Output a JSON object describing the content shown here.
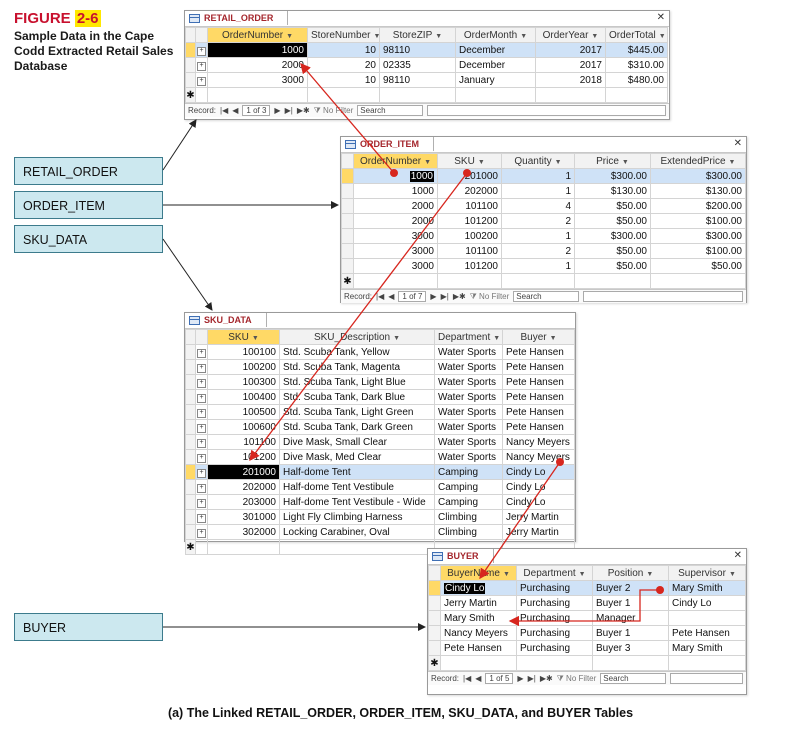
{
  "figure": {
    "label": "FIGURE",
    "number": "2-6",
    "caption": "Sample Data in the Cape Codd Extracted Retail Sales Database",
    "bottom_caption": "(a) The Linked RETAIL_ORDER, ORDER_ITEM, SKU_DATA, and BUYER Tables"
  },
  "side_labels": [
    "RETAIL_ORDER",
    "ORDER_ITEM",
    "SKU_DATA",
    "BUYER"
  ],
  "retail_order": {
    "title": "RETAIL_ORDER",
    "columns": [
      "OrderNumber",
      "StoreNumber",
      "StoreZIP",
      "OrderMonth",
      "OrderYear",
      "OrderTotal"
    ],
    "rows": [
      [
        "1000",
        "10",
        "98110",
        "December",
        "2017",
        "$445.00"
      ],
      [
        "2000",
        "20",
        "02335",
        "December",
        "2017",
        "$310.00"
      ],
      [
        "3000",
        "10",
        "98110",
        "January",
        "2018",
        "$480.00"
      ]
    ],
    "record_label": "Record:",
    "record_pos": "1 of 3",
    "filter": "No Filter",
    "search": "Search"
  },
  "order_item": {
    "title": "ORDER_ITEM",
    "columns": [
      "OrderNumber",
      "SKU",
      "Quantity",
      "Price",
      "ExtendedPrice"
    ],
    "rows": [
      [
        "1000",
        "201000",
        "1",
        "$300.00",
        "$300.00"
      ],
      [
        "1000",
        "202000",
        "1",
        "$130.00",
        "$130.00"
      ],
      [
        "2000",
        "101100",
        "4",
        "$50.00",
        "$200.00"
      ],
      [
        "2000",
        "101200",
        "2",
        "$50.00",
        "$100.00"
      ],
      [
        "3000",
        "100200",
        "1",
        "$300.00",
        "$300.00"
      ],
      [
        "3000",
        "101100",
        "2",
        "$50.00",
        "$100.00"
      ],
      [
        "3000",
        "101200",
        "1",
        "$50.00",
        "$50.00"
      ]
    ],
    "record_label": "Record:",
    "record_pos": "1 of 7",
    "filter": "No Filter",
    "search": "Search"
  },
  "sku_data": {
    "title": "SKU_DATA",
    "columns": [
      "SKU",
      "SKU_Description",
      "Department",
      "Buyer"
    ],
    "rows": [
      [
        "100100",
        "Std. Scuba Tank, Yellow",
        "Water Sports",
        "Pete Hansen"
      ],
      [
        "100200",
        "Std. Scuba Tank, Magenta",
        "Water Sports",
        "Pete Hansen"
      ],
      [
        "100300",
        "Std. Scuba Tank, Light Blue",
        "Water Sports",
        "Pete Hansen"
      ],
      [
        "100400",
        "Std. Scuba Tank, Dark Blue",
        "Water Sports",
        "Pete Hansen"
      ],
      [
        "100500",
        "Std. Scuba Tank, Light Green",
        "Water Sports",
        "Pete Hansen"
      ],
      [
        "100600",
        "Std. Scuba Tank, Dark Green",
        "Water Sports",
        "Pete Hansen"
      ],
      [
        "101100",
        "Dive Mask, Small Clear",
        "Water Sports",
        "Nancy Meyers"
      ],
      [
        "101200",
        "Dive Mask, Med Clear",
        "Water Sports",
        "Nancy Meyers"
      ],
      [
        "201000",
        "Half-dome Tent",
        "Camping",
        "Cindy Lo"
      ],
      [
        "202000",
        "Half-dome Tent Vestibule",
        "Camping",
        "Cindy Lo"
      ],
      [
        "203000",
        "Half-dome Tent Vestibule - Wide",
        "Camping",
        "Cindy Lo"
      ],
      [
        "301000",
        "Light Fly Climbing Harness",
        "Climbing",
        "Jerry Martin"
      ],
      [
        "302000",
        "Locking Carabiner, Oval",
        "Climbing",
        "Jerry Martin"
      ]
    ]
  },
  "buyer": {
    "title": "BUYER",
    "columns": [
      "BuyerName",
      "Department",
      "Position",
      "Supervisor"
    ],
    "rows": [
      [
        "Cindy Lo",
        "Purchasing",
        "Buyer 2",
        "Mary Smith"
      ],
      [
        "Jerry Martin",
        "Purchasing",
        "Buyer 1",
        "Cindy Lo"
      ],
      [
        "Mary Smith",
        "Purchasing",
        "Manager",
        ""
      ],
      [
        "Nancy Meyers",
        "Purchasing",
        "Buyer 1",
        "Pete Hansen"
      ],
      [
        "Pete Hansen",
        "Purchasing",
        "Buyer 3",
        "Mary Smith"
      ]
    ],
    "record_label": "Record:",
    "record_pos": "1 of 5",
    "filter": "No Filter",
    "search": "Search"
  },
  "colors": {
    "arrow": "#d7261e",
    "header_highlight": "#ffd966",
    "selected_row": "#cfe2f7",
    "label_box": "#cce8ef"
  }
}
